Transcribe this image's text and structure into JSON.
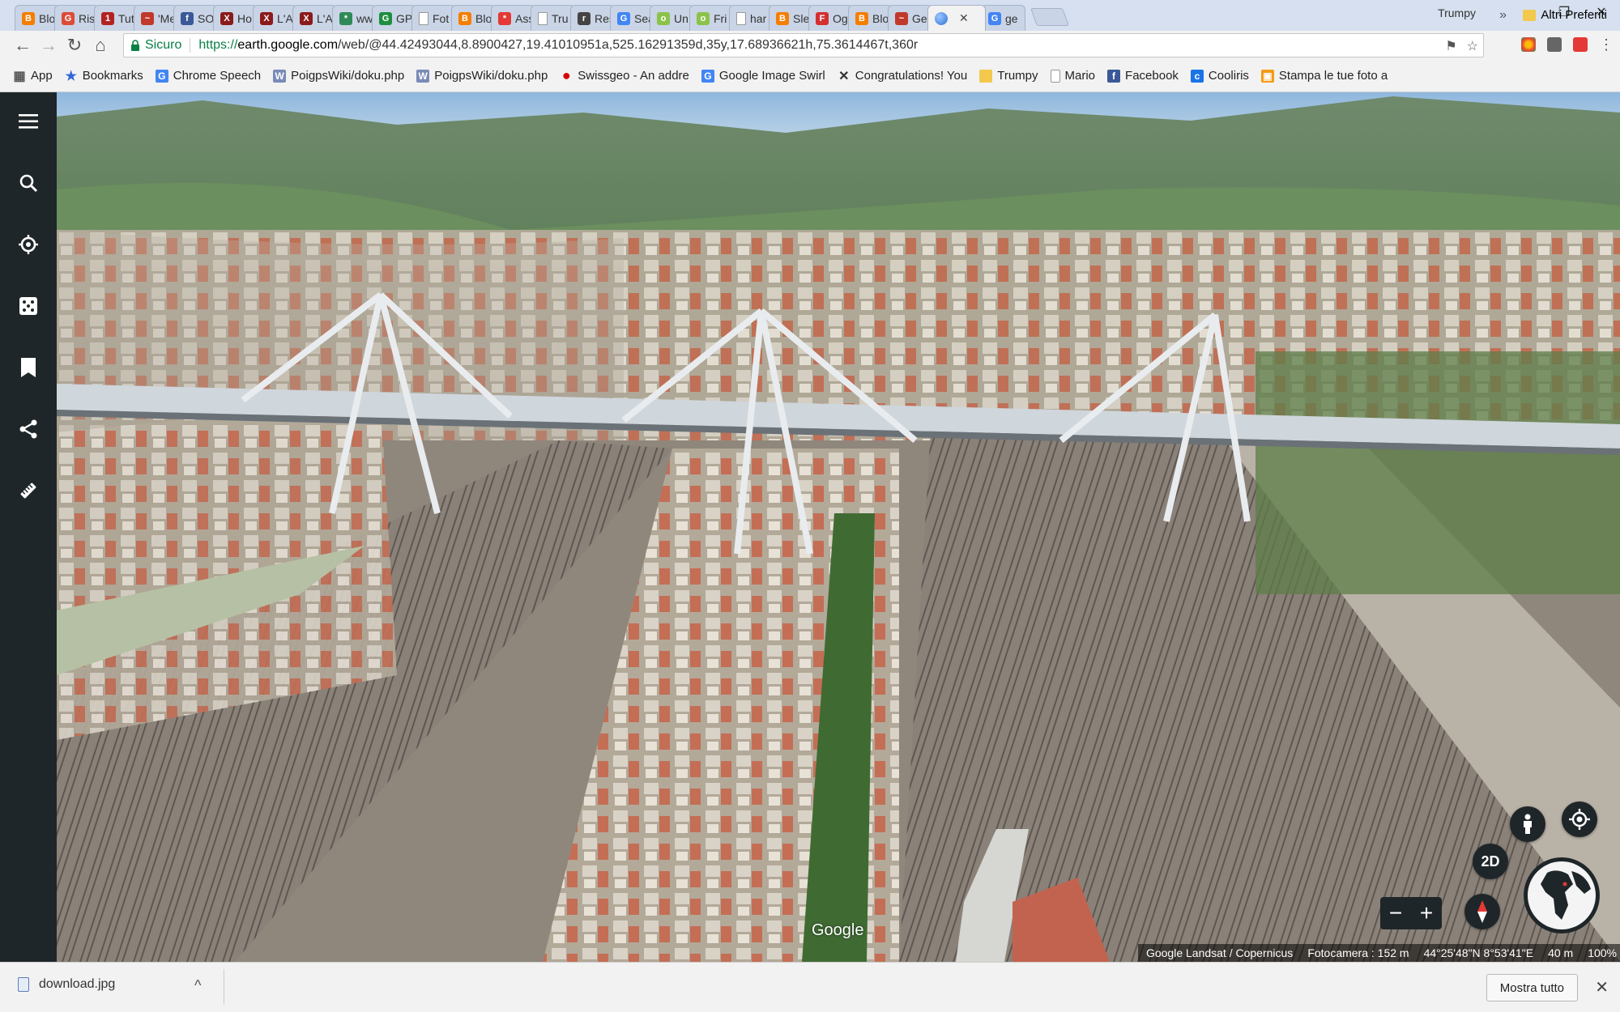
{
  "tabs": [
    {
      "label": "Blo",
      "icon": "blogger-icon",
      "color": "#f57d00",
      "glyph": "B"
    },
    {
      "label": "Ris",
      "icon": "google-plus-icon",
      "color": "#dd4b39",
      "glyph": "G"
    },
    {
      "label": "Tut",
      "icon": "red-square-icon",
      "color": "#b22222",
      "glyph": "1"
    },
    {
      "label": "'Me",
      "icon": "bird-icon",
      "color": "#c0392b",
      "glyph": "~"
    },
    {
      "label": "SO",
      "icon": "facebook-icon",
      "color": "#3b5998",
      "glyph": "f"
    },
    {
      "label": "Ho",
      "icon": "crest-icon",
      "color": "#8b1a1a",
      "glyph": "X"
    },
    {
      "label": "L'A",
      "icon": "crest-icon",
      "color": "#8b1a1a",
      "glyph": "X"
    },
    {
      "label": "L'A",
      "icon": "crest-icon",
      "color": "#8b1a1a",
      "glyph": "X"
    },
    {
      "label": "ww",
      "icon": "gear-flower-icon",
      "color": "#2e8b57",
      "glyph": "*"
    },
    {
      "label": "GP",
      "icon": "gps-icon",
      "color": "#1e8e3e",
      "glyph": "G"
    },
    {
      "label": "Fot",
      "icon": "page-icon",
      "color": "#9e9e9e",
      "glyph": ""
    },
    {
      "label": "Blo",
      "icon": "blogger-icon",
      "color": "#f57d00",
      "glyph": "B"
    },
    {
      "label": "Ass",
      "icon": "pinwheel-icon",
      "color": "#e53935",
      "glyph": "*"
    },
    {
      "label": "Tru",
      "icon": "page-icon",
      "color": "#9e9e9e",
      "glyph": ""
    },
    {
      "label": "Res",
      "icon": "researchgate-icon",
      "color": "#444444",
      "glyph": "r"
    },
    {
      "label": "Sea",
      "icon": "google-icon",
      "color": "#4285f4",
      "glyph": "G"
    },
    {
      "label": "Un",
      "icon": "green-circle-icon",
      "color": "#8bc34a",
      "glyph": "o"
    },
    {
      "label": "Fri",
      "icon": "green-circle-icon",
      "color": "#8bc34a",
      "glyph": "o"
    },
    {
      "label": "har",
      "icon": "page-icon",
      "color": "#9e9e9e",
      "glyph": ""
    },
    {
      "label": "Sle",
      "icon": "blogger-icon",
      "color": "#f57d00",
      "glyph": "B"
    },
    {
      "label": "Og",
      "icon": "fc-icon",
      "color": "#d32f2f",
      "glyph": "F"
    },
    {
      "label": "Blo",
      "icon": "blogger-icon",
      "color": "#f57d00",
      "glyph": "B"
    },
    {
      "label": "Ge",
      "icon": "bird-icon",
      "color": "#c0392b",
      "glyph": "~"
    },
    {
      "label": "",
      "icon": "google-earth-icon",
      "color": "#4a90e2",
      "glyph": "",
      "active": true
    },
    {
      "label": "ge",
      "icon": "google-icon",
      "color": "#4285f4",
      "glyph": "G"
    }
  ],
  "window": {
    "profile": "Trumpy",
    "minimize": "–",
    "maximize": "❐",
    "close": "✕"
  },
  "toolbar": {
    "back": "←",
    "forward": "→",
    "reload": "↻",
    "home": "⌂",
    "secure_label": "Sicuro",
    "url_scheme": "https://",
    "url_host": "earth.google.com",
    "url_path": "/web/@44.42493044,8.8900427,19.41010951a,525.16291359d,35y,17.68936621h,75.3614467t,360r"
  },
  "bookmarks": [
    {
      "label": "App",
      "icon": "apps-grid-icon",
      "color": "#555555",
      "glyph": "▦"
    },
    {
      "label": "Bookmarks",
      "icon": "star-icon",
      "color": "#3367d6",
      "glyph": "★"
    },
    {
      "label": "Chrome Speech",
      "icon": "google-icon",
      "color": "#4285f4",
      "glyph": "G"
    },
    {
      "label": "PoigpsWiki/doku.php",
      "icon": "wiki-icon",
      "color": "#7a8ab8",
      "glyph": "W"
    },
    {
      "label": "PoigpsWiki/doku.php",
      "icon": "wiki-icon",
      "color": "#7a8ab8",
      "glyph": "W"
    },
    {
      "label": "Swissgeo - An addre",
      "icon": "red-dot-icon",
      "color": "#d50000",
      "glyph": "●"
    },
    {
      "label": "Google Image Swirl",
      "icon": "google-icon",
      "color": "#4285f4",
      "glyph": "G"
    },
    {
      "label": "Congratulations! You",
      "icon": "x-icon",
      "color": "#333333",
      "glyph": "✕"
    },
    {
      "label": "Trumpy",
      "icon": "folder-icon",
      "color": "#f2c94c",
      "glyph": ""
    },
    {
      "label": "Mario",
      "icon": "page-icon",
      "color": "#9e9e9e",
      "glyph": ""
    },
    {
      "label": "Facebook",
      "icon": "facebook-icon",
      "color": "#3b5998",
      "glyph": "f"
    },
    {
      "label": "Cooliris",
      "icon": "cooliris-icon",
      "color": "#1a73e8",
      "glyph": "c"
    },
    {
      "label": "Stampa le tue foto a",
      "icon": "photo-icon",
      "color": "#f39c12",
      "glyph": "▣"
    }
  ],
  "bookmarks_more": "»",
  "bookmarks_other": "Altri Preferiti",
  "earth": {
    "watermark": "Google",
    "attribution": "Google  Landsat / Copernicus",
    "camera": "Fotocamera : 152 m",
    "coords": "44°25'48\"N 8°53'41\"E",
    "scale": "40 m",
    "zoom": "100%",
    "mode_2d": "2D",
    "zoom_out": "−",
    "zoom_in": "+"
  },
  "sidebar": [
    "menu-icon",
    "search-icon",
    "voyager-icon",
    "feeling-lucky-icon",
    "projects-icon",
    "share-icon",
    "measure-icon"
  ],
  "downloads": {
    "file": "download.jpg",
    "chevron": "^",
    "show_all": "Mostra tutto",
    "close": "✕"
  }
}
